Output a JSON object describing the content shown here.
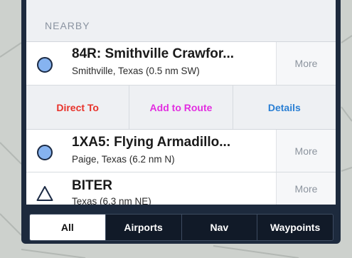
{
  "section": {
    "header": "NEARBY"
  },
  "results": [
    {
      "icon": "airport-circle-icon",
      "title": "84R: Smithville Crawfor...",
      "subtitle": "Smithville, Texas  (0.5 nm SW)",
      "more_label": "More"
    },
    {
      "icon": "airport-circle-icon",
      "title": "1XA5: Flying Armadillo...",
      "subtitle": "Paige, Texas  (6.2 nm N)",
      "more_label": "More"
    },
    {
      "icon": "waypoint-triangle-icon",
      "title": "BITER",
      "subtitle": "Texas  (6.3 nm NE)",
      "more_label": "More"
    }
  ],
  "actions": {
    "direct_to": "Direct To",
    "add_to_route": "Add to Route",
    "details": "Details",
    "colors": {
      "direct_to": "#e8322a",
      "add_to_route": "#e22ee0",
      "details": "#2a7fd4"
    }
  },
  "filter_tabs": {
    "items": [
      "All",
      "Airports",
      "Nav",
      "Waypoints"
    ],
    "selected": "All"
  },
  "colors": {
    "airport_fill": "#86b3f0",
    "panel_bg": "#1d2a3d"
  }
}
